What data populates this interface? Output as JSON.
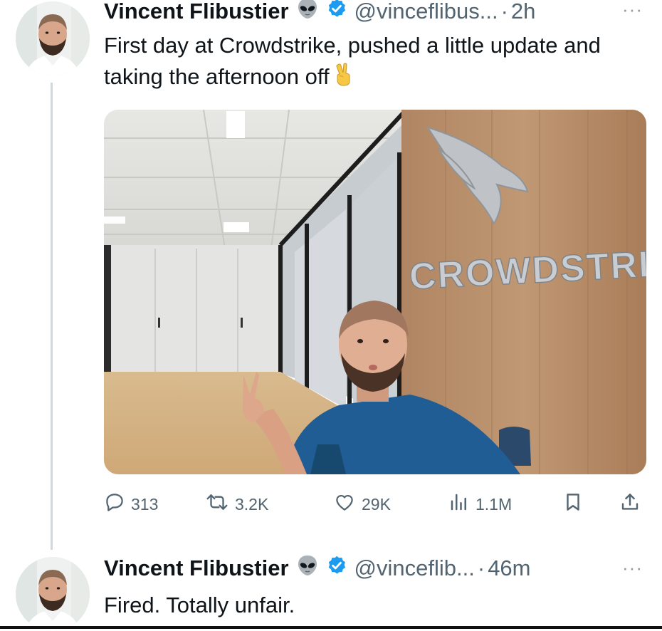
{
  "tweets": [
    {
      "name": "Vincent Flibustier",
      "handle": "@vinceflibus...",
      "separator": "·",
      "time": "2h",
      "text": "First day at Crowdstrike, pushed a little update and taking the afternoon off",
      "more": "···",
      "stats": {
        "replies": "313",
        "retweets": "3.2K",
        "likes": "29K",
        "views": "1.1M"
      },
      "media": {
        "sign_text": "CROWDSTRIKE"
      }
    },
    {
      "name": "Vincent Flibustier",
      "handle": "@vinceflib...",
      "separator": "·",
      "time": "46m",
      "text": "Fired. Totally unfair.",
      "more": "···"
    }
  ],
  "icons": {
    "alien": "alien-emoji",
    "verified": "verified-badge",
    "victory": "victory-hand-emoji",
    "reply": "reply-icon",
    "retweet": "retweet-icon",
    "like": "heart-icon",
    "views": "views-icon",
    "bookmark": "bookmark-icon",
    "share": "share-icon"
  },
  "colors": {
    "verified": "#1d9bf0",
    "text": "#0f1419",
    "secondary": "#536471",
    "thread_line": "#cfd9de"
  }
}
